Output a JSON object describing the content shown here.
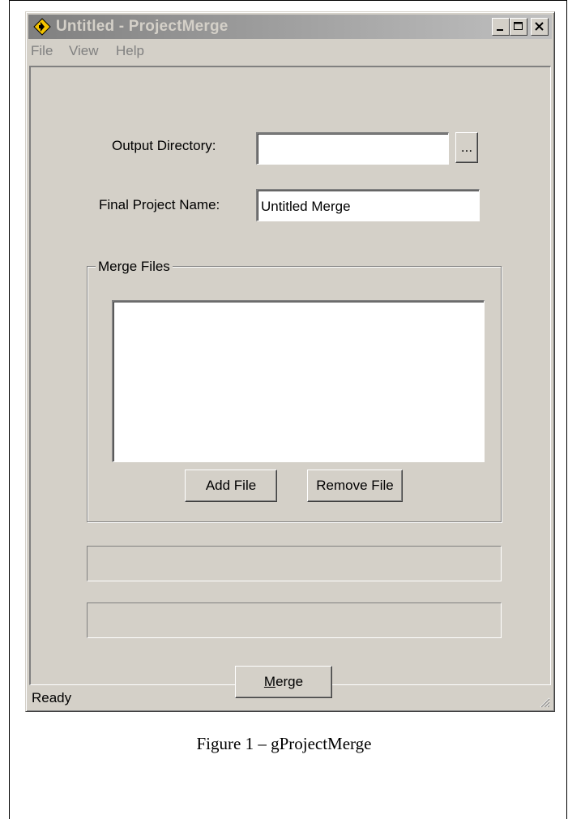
{
  "window": {
    "title": "Untitled - ProjectMerge",
    "icon": "app-icon"
  },
  "menu": {
    "items": [
      "File",
      "View",
      "Help"
    ]
  },
  "form": {
    "output_directory_label": "Output Directory:",
    "output_directory_value": "",
    "browse_label": "...",
    "final_project_name_label": "Final Project Name:",
    "final_project_name_value": "Untitled Merge"
  },
  "merge_files": {
    "group_label": "Merge Files",
    "items": [],
    "add_file_label": "Add File",
    "remove_file_label": "Remove File"
  },
  "merge_button": {
    "mnemonic": "M",
    "rest": "erge"
  },
  "status": {
    "text": "Ready"
  },
  "caption": "Figure 1 – gProjectMerge"
}
